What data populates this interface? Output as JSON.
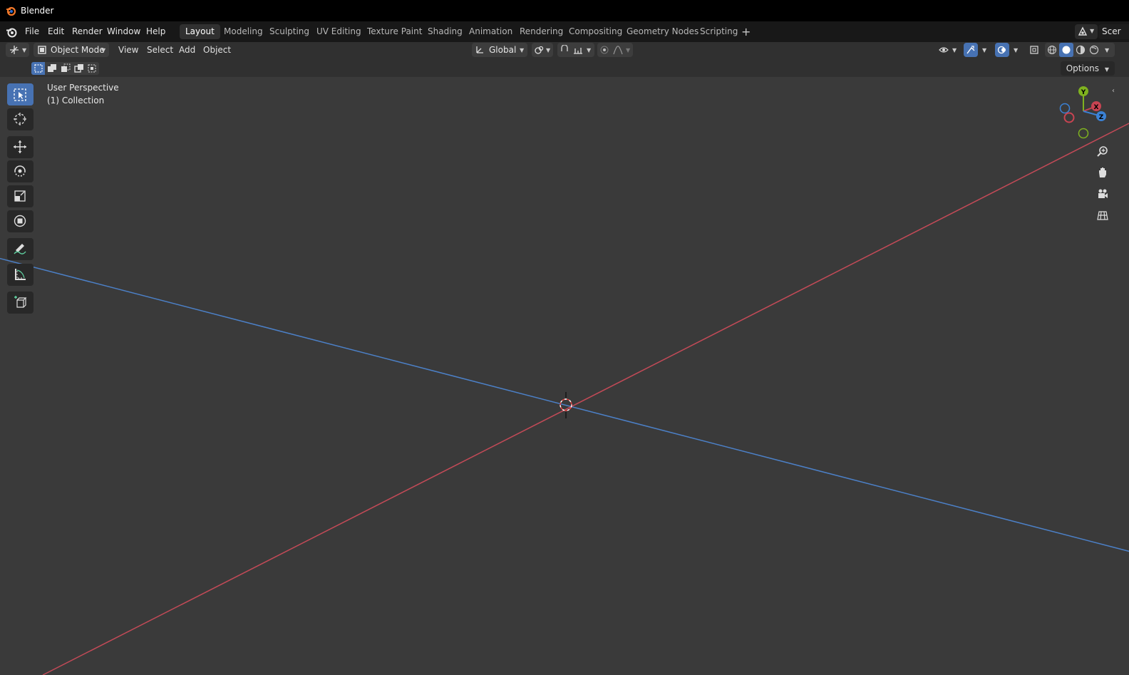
{
  "app": {
    "title": "Blender"
  },
  "menu": {
    "file": "File",
    "edit": "Edit",
    "render": "Render",
    "window": "Window",
    "help": "Help"
  },
  "workspaces": [
    {
      "label": "Layout",
      "active": true
    },
    {
      "label": "Modeling"
    },
    {
      "label": "Sculpting"
    },
    {
      "label": "UV Editing"
    },
    {
      "label": "Texture Paint"
    },
    {
      "label": "Shading"
    },
    {
      "label": "Animation"
    },
    {
      "label": "Rendering"
    },
    {
      "label": "Compositing"
    },
    {
      "label": "Geometry Nodes"
    },
    {
      "label": "Scripting"
    }
  ],
  "scene_label": "Scer",
  "header": {
    "mode": "Object Mode",
    "view": "View",
    "select": "Select",
    "add": "Add",
    "object": "Object",
    "orientation": "Global"
  },
  "options_label": "Options",
  "viewport": {
    "perspective_label": "User Perspective",
    "collection_label": "(1) Collection"
  },
  "gizmo": {
    "x": "X",
    "y": "Y",
    "z": "Z"
  },
  "colors": {
    "x_axis": "#c94452",
    "y_axis": "#7fb21f",
    "z_axis": "#3b82d6",
    "active_tool": "#4772b3",
    "background": "#3a3a3a"
  },
  "icons": {
    "toolbar": [
      "select-box-icon",
      "cursor-icon",
      "move-icon",
      "rotate-icon",
      "scale-icon",
      "transform-icon",
      "annotate-icon",
      "measure-icon",
      "add-cube-icon"
    ],
    "navigation": [
      "zoom-icon",
      "hand-icon",
      "camera-icon",
      "grid-icon"
    ]
  }
}
